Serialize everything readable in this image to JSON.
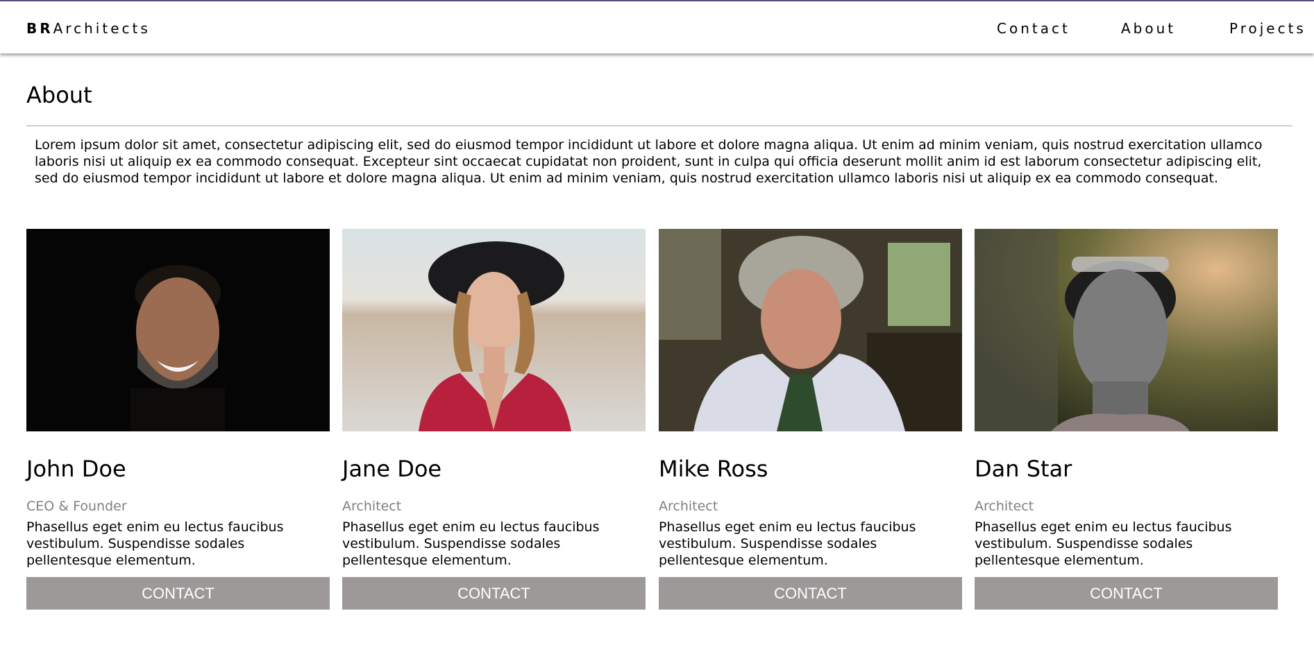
{
  "header": {
    "brand_bold": "BR",
    "brand_rest": "Architects",
    "nav": {
      "contact": "Contact",
      "about": "About",
      "projects": "Projects"
    }
  },
  "about": {
    "title": "About",
    "intro": "Lorem ipsum dolor sit amet, consectetur adipiscing elit, sed do eiusmod tempor incididunt ut labore et dolore magna aliqua. Ut enim ad minim veniam, quis nostrud exercitation ullamco laboris nisi ut aliquip ex ea commodo consequat. Excepteur sint occaecat cupidatat non proident, sunt in culpa qui officia deserunt mollit anim id est laborum consectetur adipiscing elit, sed do eiusmod tempor incididunt ut labore et dolore magna aliqua. Ut enim ad minim veniam, quis nostrud exercitation ullamco laboris nisi ut aliquip ex ea commodo consequat."
  },
  "team": [
    {
      "name": "John Doe",
      "role": "CEO & Founder",
      "description": "Phasellus eget enim eu lectus faucibus vestibulum. Suspendisse sodales pellentesque elementum.",
      "button": "CONTACT"
    },
    {
      "name": "Jane Doe",
      "role": "Architect",
      "description": "Phasellus eget enim eu lectus faucibus vestibulum. Suspendisse sodales pellentesque elementum.",
      "button": "CONTACT"
    },
    {
      "name": "Mike Ross",
      "role": "Architect",
      "description": "Phasellus eget enim eu lectus faucibus vestibulum. Suspendisse sodales pellentesque elementum.",
      "button": "CONTACT"
    },
    {
      "name": "Dan Star",
      "role": "Architect",
      "description": "Phasellus eget enim eu lectus faucibus vestibulum. Suspendisse sodales pellentesque elementum.",
      "button": "CONTACT"
    }
  ],
  "colors": {
    "top_accent": "#5b4a86",
    "button_bg": "#9d9999",
    "role_text": "#808080"
  }
}
